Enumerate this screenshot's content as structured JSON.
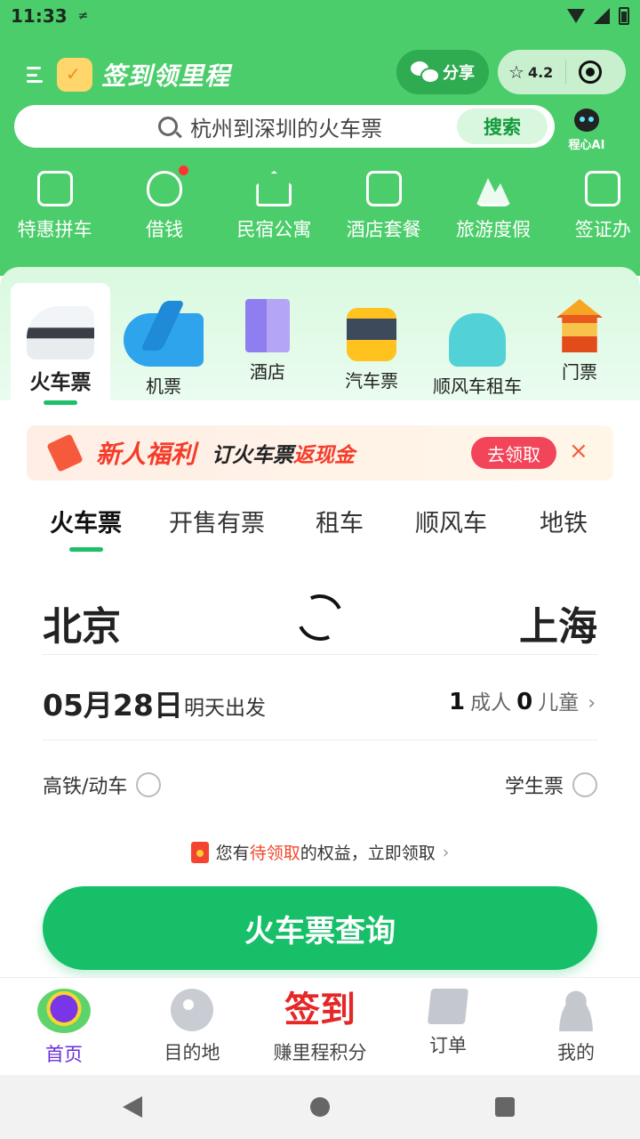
{
  "status_bar": {
    "time": "11:33",
    "extra": "≠"
  },
  "app_bar": {
    "brand": "签到领里程",
    "share_label": "分享",
    "rating": "4.2"
  },
  "search": {
    "placeholder": "杭州到深圳的火车票",
    "button": "搜索",
    "ai_label": "程心AI"
  },
  "quick_links": [
    {
      "label": "特惠拼车",
      "icon": "car-pool-icon"
    },
    {
      "label": "借钱",
      "icon": "money-bag-icon",
      "badge_dot": true
    },
    {
      "label": "民宿公寓",
      "icon": "house-icon"
    },
    {
      "label": "酒店套餐",
      "icon": "building-icon"
    },
    {
      "label": "旅游度假",
      "icon": "mountain-icon"
    },
    {
      "label": "签证办",
      "icon": "passport-icon"
    }
  ],
  "categories": [
    {
      "label": "火车票",
      "icon": "train-icon",
      "active": true
    },
    {
      "label": "机票",
      "icon": "plane-icon"
    },
    {
      "label": "酒店",
      "icon": "hotel-icon"
    },
    {
      "label": "汽车票",
      "icon": "bus-icon"
    },
    {
      "label": "顺风车租车",
      "icon": "car-icon"
    },
    {
      "label": "门票",
      "icon": "landmark-icon"
    }
  ],
  "promo": {
    "title": "新人福利",
    "subtitle_a": "订火车票",
    "subtitle_b": "返现金",
    "button": "去领取",
    "close": "×"
  },
  "sub_tabs": [
    {
      "label": "火车票",
      "active": true
    },
    {
      "label": "开售有票"
    },
    {
      "label": "租车"
    },
    {
      "label": "顺风车"
    },
    {
      "label": "地铁"
    }
  ],
  "route": {
    "from": "北京",
    "to": "上海"
  },
  "date": {
    "value": "05月28日",
    "note": "明天出发"
  },
  "passengers": {
    "adults": "1",
    "adults_label": "成人",
    "children": "0",
    "children_label": "儿童"
  },
  "options": {
    "high_speed": "高铁/动车",
    "student": "学生票"
  },
  "benefit": {
    "prefix": "您有",
    "highlight": "待领取",
    "suffix": "的权益，立即领取"
  },
  "query_button": "火车票查询",
  "bottom_nav": [
    {
      "label": "首页",
      "active": true,
      "icon": "home-icon"
    },
    {
      "label": "目的地",
      "icon": "globe-icon"
    },
    {
      "label": "赚里程积分",
      "glyph": "签到"
    },
    {
      "label": "订单",
      "icon": "order-icon"
    },
    {
      "label": "我的",
      "icon": "person-icon"
    }
  ],
  "colors": {
    "header_green": "#4ccd6b",
    "accent_green": "#17bf69",
    "promo_red": "#f53d2b",
    "active_purple": "#6b2ed9"
  }
}
